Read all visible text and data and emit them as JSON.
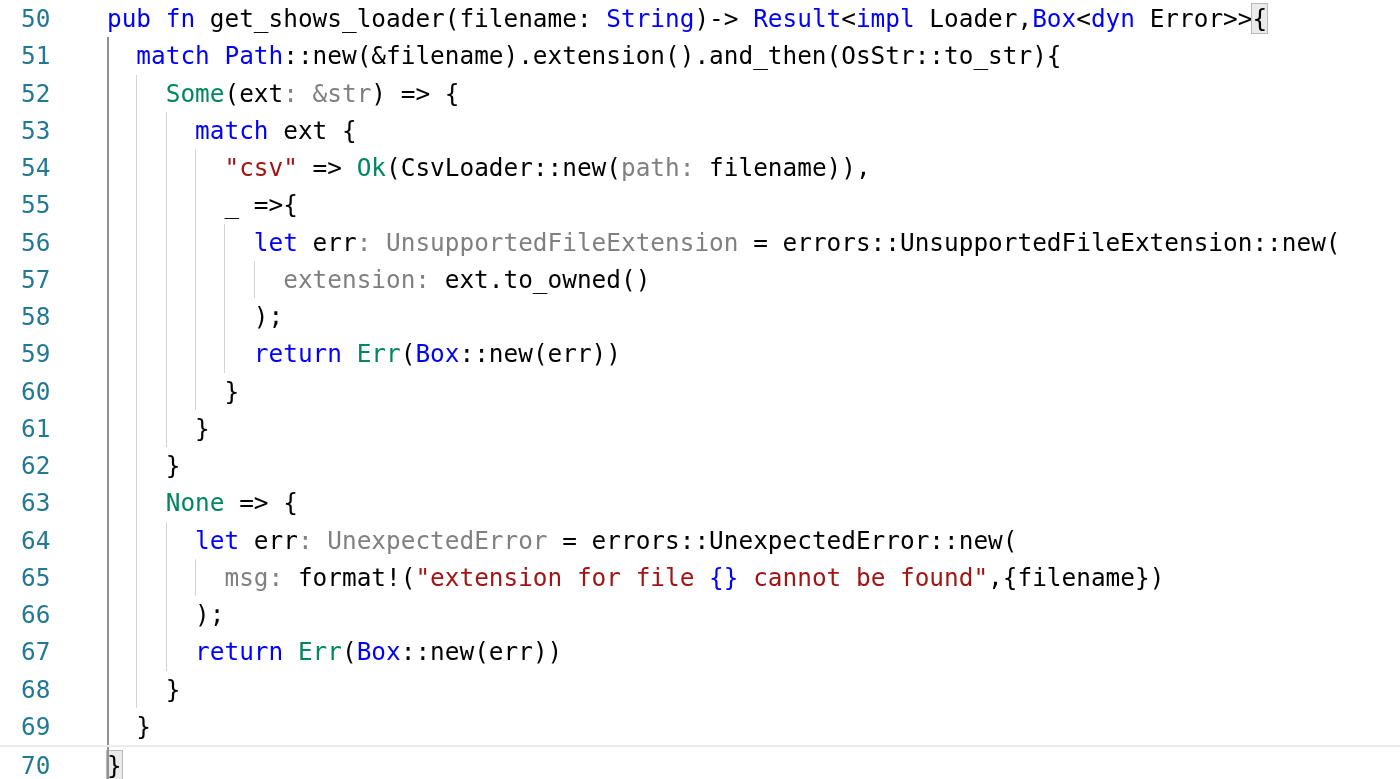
{
  "lines": [
    {
      "number": "50",
      "tokens": [
        {
          "kind": "keyword",
          "text": "pub fn"
        },
        {
          "kind": "plain",
          "text": " get_shows_loader(filename: "
        },
        {
          "kind": "type",
          "text": "String"
        },
        {
          "kind": "plain",
          "text": ")-> "
        },
        {
          "kind": "type",
          "text": "Result"
        },
        {
          "kind": "plain",
          "text": "<"
        },
        {
          "kind": "keyword",
          "text": "impl"
        },
        {
          "kind": "plain",
          "text": " Loader,"
        },
        {
          "kind": "type",
          "text": "Box"
        },
        {
          "kind": "plain",
          "text": "<"
        },
        {
          "kind": "keyword",
          "text": "dyn"
        },
        {
          "kind": "plain",
          "text": " Error>>"
        },
        {
          "kind": "bracket_match",
          "text": "{"
        }
      ]
    },
    {
      "number": "51",
      "tokens": [
        {
          "kind": "keyword",
          "text": "  match"
        },
        {
          "kind": "type",
          "text": " Path"
        },
        {
          "kind": "plain",
          "text": "::new(&filename).extension().and_then(OsStr::to_str){"
        }
      ]
    },
    {
      "number": "52",
      "tokens": [
        {
          "kind": "variant",
          "text": "    Some"
        },
        {
          "kind": "plain",
          "text": "(ext"
        },
        {
          "kind": "hint",
          "text": ": &str"
        },
        {
          "kind": "plain",
          "text": ") => {"
        }
      ]
    },
    {
      "number": "53",
      "tokens": [
        {
          "kind": "keyword",
          "text": "      match"
        },
        {
          "kind": "plain",
          "text": " ext {"
        }
      ]
    },
    {
      "number": "54",
      "tokens": [
        {
          "kind": "string",
          "text": "        \"csv\""
        },
        {
          "kind": "plain",
          "text": " => "
        },
        {
          "kind": "variant",
          "text": "Ok"
        },
        {
          "kind": "plain",
          "text": "(CsvLoader::new("
        },
        {
          "kind": "hint",
          "text": "path:"
        },
        {
          "kind": "plain",
          "text": " filename)),"
        }
      ]
    },
    {
      "number": "55",
      "tokens": [
        {
          "kind": "plain",
          "text": "        _ =>{"
        }
      ]
    },
    {
      "number": "56",
      "tokens": [
        {
          "kind": "keyword",
          "text": "          let"
        },
        {
          "kind": "plain",
          "text": " err"
        },
        {
          "kind": "hint",
          "text": ": UnsupportedFileExtension"
        },
        {
          "kind": "plain",
          "text": " = errors::UnsupportedFileExtension::new("
        }
      ]
    },
    {
      "number": "57",
      "tokens": [
        {
          "kind": "hint",
          "text": "            extension:"
        },
        {
          "kind": "plain",
          "text": " ext.to_owned()"
        }
      ]
    },
    {
      "number": "58",
      "tokens": [
        {
          "kind": "plain",
          "text": "          );"
        }
      ]
    },
    {
      "number": "59",
      "tokens": [
        {
          "kind": "keyword",
          "text": "          return"
        },
        {
          "kind": "variant",
          "text": " Err"
        },
        {
          "kind": "plain",
          "text": "("
        },
        {
          "kind": "type",
          "text": "Box"
        },
        {
          "kind": "plain",
          "text": "::new(err))"
        }
      ]
    },
    {
      "number": "60",
      "tokens": [
        {
          "kind": "plain",
          "text": "        }"
        }
      ]
    },
    {
      "number": "61",
      "tokens": [
        {
          "kind": "plain",
          "text": "      }"
        }
      ]
    },
    {
      "number": "62",
      "tokens": [
        {
          "kind": "plain",
          "text": "    }"
        }
      ]
    },
    {
      "number": "63",
      "tokens": [
        {
          "kind": "variant",
          "text": "    None"
        },
        {
          "kind": "plain",
          "text": " => {"
        }
      ]
    },
    {
      "number": "64",
      "tokens": [
        {
          "kind": "keyword",
          "text": "      let"
        },
        {
          "kind": "plain",
          "text": " err"
        },
        {
          "kind": "hint",
          "text": ": UnexpectedError"
        },
        {
          "kind": "plain",
          "text": " = errors::UnexpectedError::new("
        }
      ]
    },
    {
      "number": "65",
      "tokens": [
        {
          "kind": "hint",
          "text": "        msg:"
        },
        {
          "kind": "plain",
          "text": " format!("
        },
        {
          "kind": "string",
          "text": "\"extension for file "
        },
        {
          "kind": "type",
          "text": "{}"
        },
        {
          "kind": "string",
          "text": " cannot be found\""
        },
        {
          "kind": "plain",
          "text": ",{filename})"
        }
      ]
    },
    {
      "number": "66",
      "tokens": [
        {
          "kind": "plain",
          "text": "      );"
        }
      ]
    },
    {
      "number": "67",
      "tokens": [
        {
          "kind": "keyword",
          "text": "      return"
        },
        {
          "kind": "variant",
          "text": " Err"
        },
        {
          "kind": "plain",
          "text": "("
        },
        {
          "kind": "type",
          "text": "Box"
        },
        {
          "kind": "plain",
          "text": "::new(err))"
        }
      ]
    },
    {
      "number": "68",
      "tokens": [
        {
          "kind": "plain",
          "text": "    }"
        }
      ]
    },
    {
      "number": "69",
      "tokens": [
        {
          "kind": "plain",
          "text": "  }"
        }
      ]
    },
    {
      "number": "70",
      "tokens": [
        {
          "kind": "bracket_match",
          "text": "}"
        }
      ]
    }
  ]
}
